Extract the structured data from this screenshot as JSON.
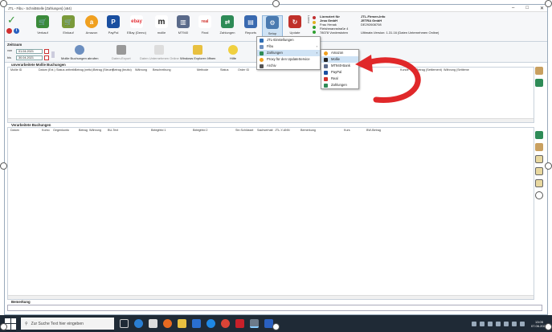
{
  "window": {
    "title": "JTL - Fibu - Schnittstelle [Zahlungen] (x64)",
    "controls": [
      "–",
      "□",
      "✕"
    ]
  },
  "ribbon": {
    "buttons": [
      {
        "label": "Verkauf",
        "color": "#3a8a3a"
      },
      {
        "label": "Einkauf",
        "color": "#7a9a3a"
      },
      {
        "label": "Amazon",
        "color": "#f0a020"
      },
      {
        "label": "PayPal",
        "color": "#1a4fa0"
      },
      {
        "label": "EBay (Demo)",
        "color": "#e43137"
      },
      {
        "label": "mollie",
        "color": "#222222"
      },
      {
        "label": "MT940",
        "color": "#5a6a8a"
      },
      {
        "label": "Final",
        "color": "#d0302a"
      },
      {
        "label": "Zahlungen",
        "color": "#2e8b57"
      },
      {
        "label": "Reports",
        "color": "#3a6ab0"
      },
      {
        "label": "Setup",
        "color": "#4a7ab0"
      },
      {
        "label": "Update",
        "color": "#c0302a"
      }
    ],
    "license_tag": "Lizenz",
    "licensee": {
      "heading": "Lizenziert für",
      "company": "Jesa GmbH",
      "name": "Frau Henak",
      "street": "Fleishmannstraße 4",
      "city": "78078 Vorderstoten"
    },
    "firm": {
      "heading": "JTL-Firmen-Info",
      "company": "JETRA GmbH",
      "id": "DE292608708",
      "version": "Ultimate-Version: 1.31.16 (Daten Unternehmen Online)"
    }
  },
  "filter": {
    "title": "Zeitraum",
    "von_label": "von",
    "bis_label": "bis",
    "von_value": "01.04.2021",
    "bis_value": "30.04.2021",
    "buttons": [
      "Mollie Buchungen abrufen",
      "Daten-Export",
      "Daten Unternehmen Online",
      "Windows Explorer öffnen",
      "Hilfe"
    ]
  },
  "upper_pane": {
    "title": "unverarbeitete Mollie Buchungen",
    "columns": [
      "Mollie ID",
      "Datum (Ext.)",
      "Status zeitreib.",
      "Betrag (netto)",
      "Betrag (Steuer)",
      "Betrag (brutto)",
      "Währung",
      "Beschreibung",
      "Methode",
      "Status",
      "Order ID",
      "Kunde",
      "Betrag (Settlement)",
      "Währung (Settleme"
    ]
  },
  "lower_pane": {
    "title": "Verarbeitete Buchungen",
    "columns": [
      "Datum",
      "Konto",
      "Gegenkonto",
      "Betrag",
      "Währung",
      "BU-Text",
      "Belegfeld 1",
      "Belegfeld 2",
      "Stn Schlüssel",
      "Sachverhalt",
      "JTL-Y-ANN",
      "Bemerkung",
      "Kurs",
      "BW-Betrag"
    ]
  },
  "bemerkung_label": "Bemerkung",
  "setup_menu": {
    "items": [
      "JTL-Einstellungen",
      "Fibu",
      "Zahlungen",
      "Proxy für den UpdateService",
      "Archiv"
    ],
    "highlighted": "Zahlungen"
  },
  "submenu": {
    "items": [
      "Amazon",
      "Mollie",
      "MT940-Bank",
      "PayPal",
      "Real",
      "Zahlungen"
    ],
    "highlighted": "Mollie"
  },
  "taskbar": {
    "search_placeholder": "Zur Suche Text hier eingeben",
    "time": "13:05",
    "date": "07.06.2021"
  },
  "colors": {
    "accent": "#cfe3f5",
    "arrow": "#e0282a"
  }
}
